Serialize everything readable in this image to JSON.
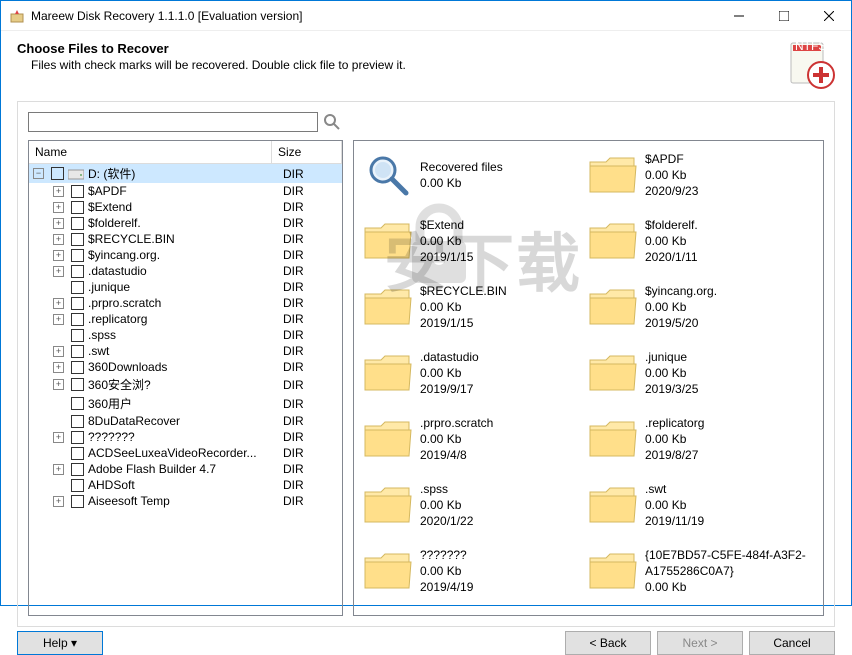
{
  "window": {
    "title": "Mareew Disk Recovery 1.1.1.0 [Evaluation version]"
  },
  "header": {
    "title": "Choose Files to Recover",
    "subtitle": "Files with check marks will be recovered. Double click file to preview it."
  },
  "search": {
    "value": "",
    "placeholder": ""
  },
  "treeHeaders": {
    "name": "Name",
    "size": "Size"
  },
  "treeRoot": {
    "name": "D: (软件)",
    "size": "DIR"
  },
  "treeItems": [
    {
      "exp": "+",
      "name": "$APDF",
      "size": "DIR"
    },
    {
      "exp": "+",
      "name": "$Extend",
      "size": "DIR"
    },
    {
      "exp": "+",
      "name": "$folderelf.",
      "size": "DIR"
    },
    {
      "exp": "+",
      "name": "$RECYCLE.BIN",
      "size": "DIR"
    },
    {
      "exp": "+",
      "name": "$yincang.org.",
      "size": "DIR"
    },
    {
      "exp": "+",
      "name": ".datastudio",
      "size": "DIR"
    },
    {
      "exp": "",
      "name": ".junique",
      "size": "DIR"
    },
    {
      "exp": "+",
      "name": ".prpro.scratch",
      "size": "DIR"
    },
    {
      "exp": "+",
      "name": ".replicatorg",
      "size": "DIR"
    },
    {
      "exp": "",
      "name": ".spss",
      "size": "DIR"
    },
    {
      "exp": "+",
      "name": ".swt",
      "size": "DIR"
    },
    {
      "exp": "+",
      "name": "360Downloads",
      "size": "DIR"
    },
    {
      "exp": "+",
      "name": "360安全浏?",
      "size": "DIR"
    },
    {
      "exp": "",
      "name": "360用户",
      "size": "DIR"
    },
    {
      "exp": "",
      "name": "8DuDataRecover",
      "size": "DIR"
    },
    {
      "exp": "+",
      "name": "???????",
      "size": "DIR"
    },
    {
      "exp": "",
      "name": "ACDSeeLuxeaVideoRecorder...",
      "size": "DIR"
    },
    {
      "exp": "+",
      "name": "Adobe Flash Builder 4.7",
      "size": "DIR"
    },
    {
      "exp": "",
      "name": "AHDSoft",
      "size": "DIR"
    },
    {
      "exp": "+",
      "name": "Aiseesoft Temp",
      "size": "DIR"
    }
  ],
  "gridItems": [
    {
      "name": "Recovered files",
      "size": "0.00 Kb",
      "date": "",
      "special": true
    },
    {
      "name": "$APDF",
      "size": "0.00 Kb",
      "date": "2020/9/23"
    },
    {
      "name": "$Extend",
      "size": "0.00 Kb",
      "date": "2019/1/15"
    },
    {
      "name": "$folderelf.",
      "size": "0.00 Kb",
      "date": "2020/1/11"
    },
    {
      "name": "$RECYCLE.BIN",
      "size": "0.00 Kb",
      "date": "2019/1/15"
    },
    {
      "name": "$yincang.org.",
      "size": "0.00 Kb",
      "date": "2019/5/20"
    },
    {
      "name": ".datastudio",
      "size": "0.00 Kb",
      "date": "2019/9/17"
    },
    {
      "name": ".junique",
      "size": "0.00 Kb",
      "date": "2019/3/25"
    },
    {
      "name": ".prpro.scratch",
      "size": "0.00 Kb",
      "date": "2019/4/8"
    },
    {
      "name": ".replicatorg",
      "size": "0.00 Kb",
      "date": "2019/8/27"
    },
    {
      "name": ".spss",
      "size": "0.00 Kb",
      "date": "2020/1/22"
    },
    {
      "name": ".swt",
      "size": "0.00 Kb",
      "date": "2019/11/19"
    },
    {
      "name": "???????",
      "size": "0.00 Kb",
      "date": "2019/4/19"
    },
    {
      "name": "{10E7BD57-C5FE-484f-A3F2-A1755286C0A7}",
      "size": "0.00 Kb",
      "date": ""
    }
  ],
  "footer": {
    "help": "Help ▾",
    "back": "< Back",
    "next": "Next >",
    "cancel": "Cancel"
  }
}
